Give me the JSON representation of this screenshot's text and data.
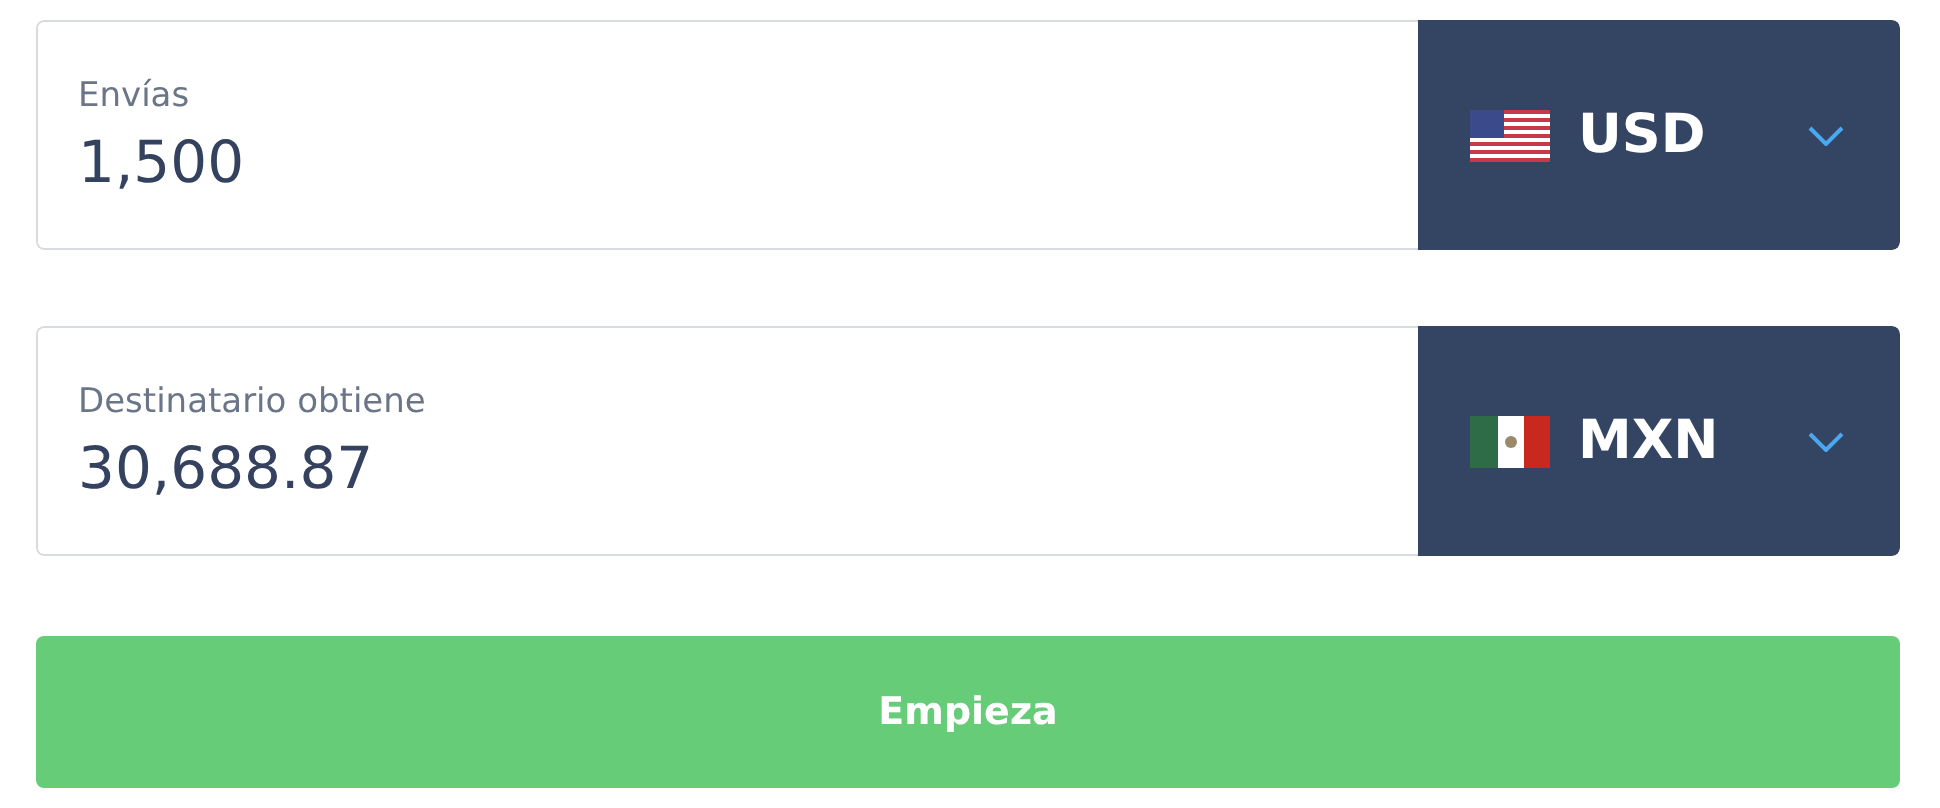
{
  "amounts": [
    {
      "label": "Envías",
      "value": "1,500",
      "currency": {
        "code": "USD",
        "kind": "us"
      }
    },
    {
      "label": "Destinatario obtiene",
      "value": "30,688.87",
      "currency": {
        "code": "MXN",
        "kind": "mx"
      }
    }
  ],
  "submit_button": {
    "label": "Empieza"
  }
}
